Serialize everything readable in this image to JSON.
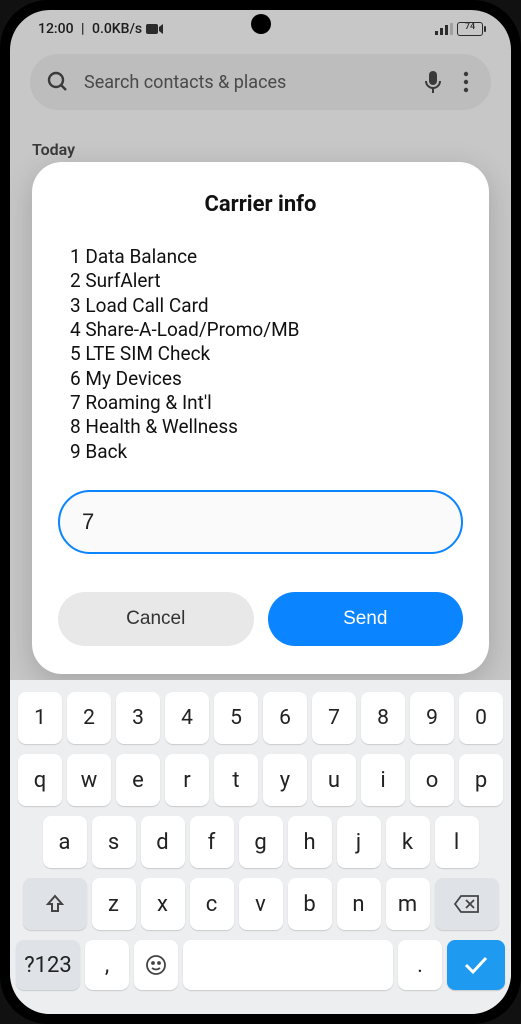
{
  "status": {
    "time": "12:00",
    "net_speed": "0.0KB/s",
    "battery_pct": "74"
  },
  "search": {
    "placeholder": "Search contacts & places"
  },
  "section_label": "Today",
  "dialog": {
    "title": "Carrier info",
    "items": [
      {
        "n": "1",
        "t": "Data Balance"
      },
      {
        "n": "2",
        "t": "SurfAlert"
      },
      {
        "n": "3",
        "t": "Load Call Card"
      },
      {
        "n": "4",
        "t": "Share-A-Load/Promo/MB"
      },
      {
        "n": "5",
        "t": "LTE SIM Check"
      },
      {
        "n": "6",
        "t": "My Devices"
      },
      {
        "n": "7",
        "t": "Roaming & Int'l"
      },
      {
        "n": "8",
        "t": "Health & Wellness"
      },
      {
        "n": "9",
        "t": "Back"
      }
    ],
    "input_value": "7",
    "cancel": "Cancel",
    "send": "Send"
  },
  "keyboard": {
    "row_num": [
      "1",
      "2",
      "3",
      "4",
      "5",
      "6",
      "7",
      "8",
      "9",
      "0"
    ],
    "row1": [
      "q",
      "w",
      "e",
      "r",
      "t",
      "y",
      "u",
      "i",
      "o",
      "p"
    ],
    "row2": [
      "a",
      "s",
      "d",
      "f",
      "g",
      "h",
      "j",
      "k",
      "l"
    ],
    "row3": [
      "z",
      "x",
      "c",
      "v",
      "b",
      "n",
      "m"
    ],
    "sym_key": "?123",
    "comma": ",",
    "period": "."
  }
}
